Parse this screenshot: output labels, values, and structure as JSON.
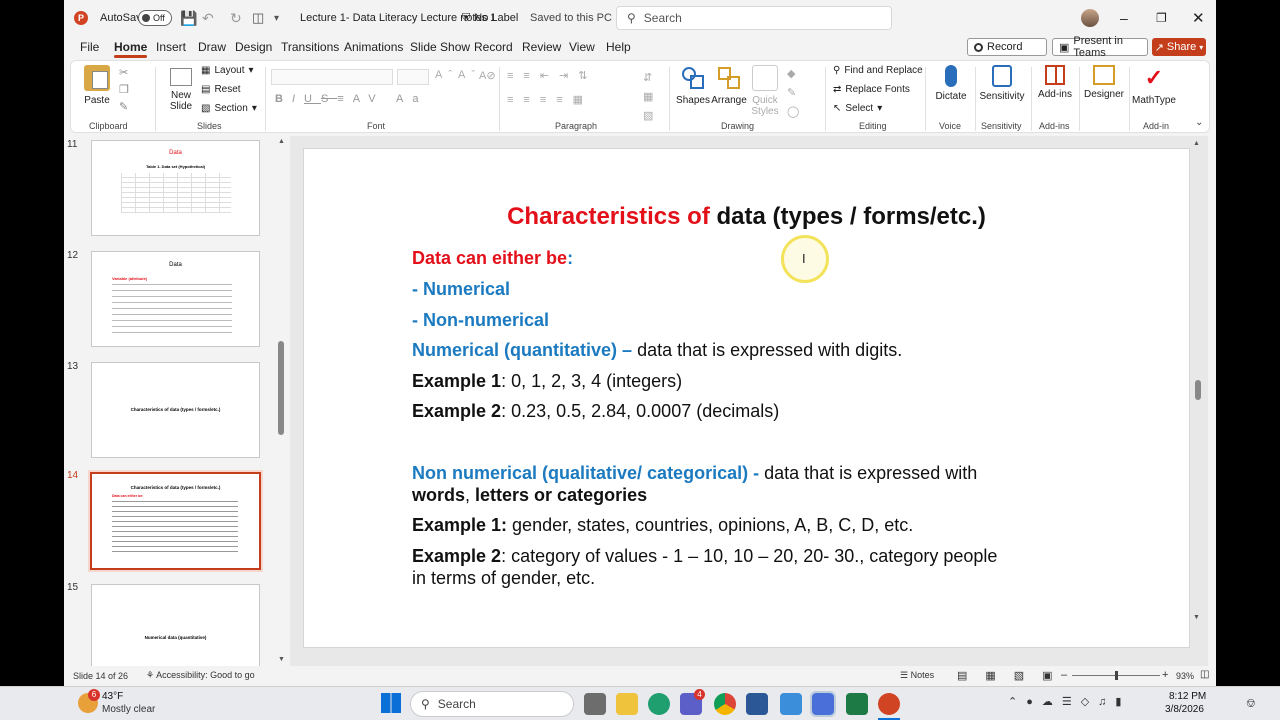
{
  "titlebar": {
    "autosave_label": "AutoSave",
    "autosave_state": "Off",
    "doc_title": "Lecture 1- Data Literacy Lecture notes 1",
    "label_status": "No Label",
    "save_status": "Saved to this PC",
    "search_placeholder": "Search"
  },
  "menu": [
    "File",
    "Home",
    "Insert",
    "Draw",
    "Design",
    "Transitions",
    "Animations",
    "Slide Show",
    "Record",
    "Review",
    "View",
    "Help"
  ],
  "menu_right": {
    "record": "Record",
    "present": "Present in Teams",
    "share": "Share"
  },
  "ribbon": {
    "clipboard": {
      "paste": "Paste",
      "label": "Clipboard"
    },
    "slides": {
      "new_slide_1": "New",
      "new_slide_2": "Slide",
      "layout": "Layout",
      "reset": "Reset",
      "section": "Section",
      "label": "Slides"
    },
    "font": {
      "label": "Font"
    },
    "paragraph": {
      "label": "Paragraph"
    },
    "drawing": {
      "shapes": "Shapes",
      "arrange": "Arrange",
      "quick_1": "Quick",
      "quick_2": "Styles",
      "label": "Drawing"
    },
    "editing": {
      "find": "Find and Replace",
      "replace_fonts": "Replace Fonts",
      "select": "Select",
      "label": "Editing"
    },
    "voice": {
      "dictate": "Dictate",
      "label": "Voice"
    },
    "sensitivity": {
      "btn": "Sensitivity",
      "label": "Sensitivity"
    },
    "addins": {
      "btn": "Add-ins",
      "label": "Add-ins"
    },
    "designer": {
      "btn": "Designer"
    },
    "mathtype": {
      "btn": "MathType",
      "label": "Add-in"
    }
  },
  "thumbnails": [
    {
      "num": "11",
      "title": "Data",
      "sub": "Table 1. Data set (Hypothetical)"
    },
    {
      "num": "12",
      "title": "Data",
      "sub": "Variable (attribute)"
    },
    {
      "num": "13",
      "title": "Characteristics of data (types / forms/etc.)",
      "sub": ""
    },
    {
      "num": "14",
      "title": "Characteristics of data (types / forms/etc.)",
      "sub": "Data can either be:"
    },
    {
      "num": "15",
      "title": "Numerical data (quantitative)",
      "sub": ""
    }
  ],
  "slide": {
    "title_red": "Characteristics of",
    "title_black": " data (types / forms/etc.)",
    "l1_red": "Data can either be",
    "l1_colon": ":",
    "l2": "- Numerical",
    "l3": "- Non-numerical",
    "l4_blue": "Numerical (quantitative) –",
    "l4_rest": " data that is expressed with digits.",
    "l5_b": "Example 1",
    "l5_rest": ": 0, 1, 2, 3, 4  (integers)",
    "l6_b": "Example 2",
    "l6_rest": ": 0.23, 0.5, 2.84, 0.0007  (decimals)",
    "l7_blue": "Non numerical (qualitative/ categorical) -",
    "l7_rest": "   data that is expressed with",
    "l8_b1": "words",
    "l8_sep": ", ",
    "l8_b2": "letters or categories",
    "l9_b": "Example 1:",
    "l9_rest": " gender, states, countries, opinions, A, B, C, D, etc.",
    "l10_b": "Example 2",
    "l10_rest": ": category of values - 1 – 10, 10 – 20, 20- 30., category people",
    "l11": "in terms of gender, etc."
  },
  "status": {
    "slide": "Slide 14 of 26",
    "accessibility": "Accessibility: Good to go",
    "notes": "Notes",
    "zoom": "93%"
  },
  "taskbar": {
    "temp": "43°F",
    "weather": "Mostly clear",
    "search": "Search",
    "time": "8:12 PM",
    "date": "3/8/2026",
    "badge": "4",
    "weather_badge": "6"
  },
  "colors": {
    "accent": "#c43e1c",
    "red_text": "#e3101a",
    "blue_text": "#1b7ac0"
  }
}
